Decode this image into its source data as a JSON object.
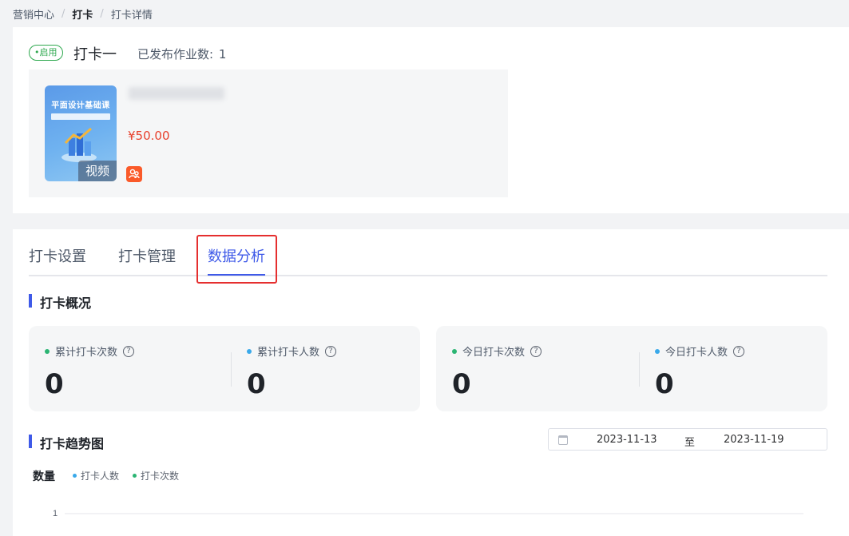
{
  "breadcrumb": {
    "items": [
      "营销中心",
      "打卡",
      "打卡详情"
    ],
    "separator": "/"
  },
  "header": {
    "status_tag": "•启用",
    "title": "打卡一",
    "published_label": "已发布作业数:",
    "published_count": "1"
  },
  "course": {
    "cover_title": "平面设计基础课",
    "cover_type": "视频",
    "price": "¥50.00"
  },
  "tabs": [
    {
      "label": "打卡设置",
      "active": false
    },
    {
      "label": "打卡管理",
      "active": false
    },
    {
      "label": "数据分析",
      "active": true
    }
  ],
  "overview": {
    "title": "打卡概况",
    "stats": [
      {
        "label": "累计打卡次数",
        "value": "0",
        "dot_color": "#2bb573"
      },
      {
        "label": "累计打卡人数",
        "value": "0",
        "dot_color": "#3aa9ea"
      },
      {
        "label": "今日打卡次数",
        "value": "0",
        "dot_color": "#2bb573"
      },
      {
        "label": "今日打卡人数",
        "value": "0",
        "dot_color": "#3aa9ea"
      }
    ],
    "help_glyph": "?"
  },
  "trend": {
    "title": "打卡趋势图",
    "date_start": "2023-11-13",
    "date_to": "至",
    "date_end": "2023-11-19"
  },
  "chart_data": {
    "type": "line",
    "ylabel": "数量",
    "series": [
      {
        "name": "打卡人数",
        "color": "#3aa9ea",
        "values": []
      },
      {
        "name": "打卡次数",
        "color": "#2bb573",
        "values": []
      }
    ],
    "yticks": [
      "1"
    ],
    "grid": true,
    "legend_position": "top-left"
  },
  "colors": {
    "accent": "#3f5ae8",
    "price": "#e8412d",
    "status": "#2fa84f",
    "highlight": "#e52f2f"
  }
}
